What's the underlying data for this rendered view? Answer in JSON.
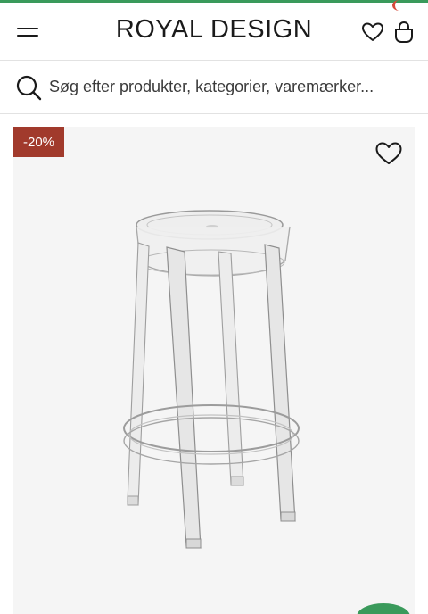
{
  "header": {
    "logo_text": "ROYAL DESIGN",
    "menu_icon": "hamburger-icon",
    "wishlist_icon": "heart-icon",
    "bag_icon": "shopping-bag-icon"
  },
  "search": {
    "placeholder": "Søg efter produkter, kategorier, varemærker...",
    "icon": "search-icon"
  },
  "product": {
    "discount_label": "-20%",
    "favorite_icon": "heart-outline-icon",
    "image_subject": "clear-acrylic-bar-stool"
  },
  "colors": {
    "accent_green": "#3a9a5b",
    "badge_red": "#a13a2c",
    "card_bg": "#f5f5f5",
    "cart_indicator": "#d64a3b"
  }
}
